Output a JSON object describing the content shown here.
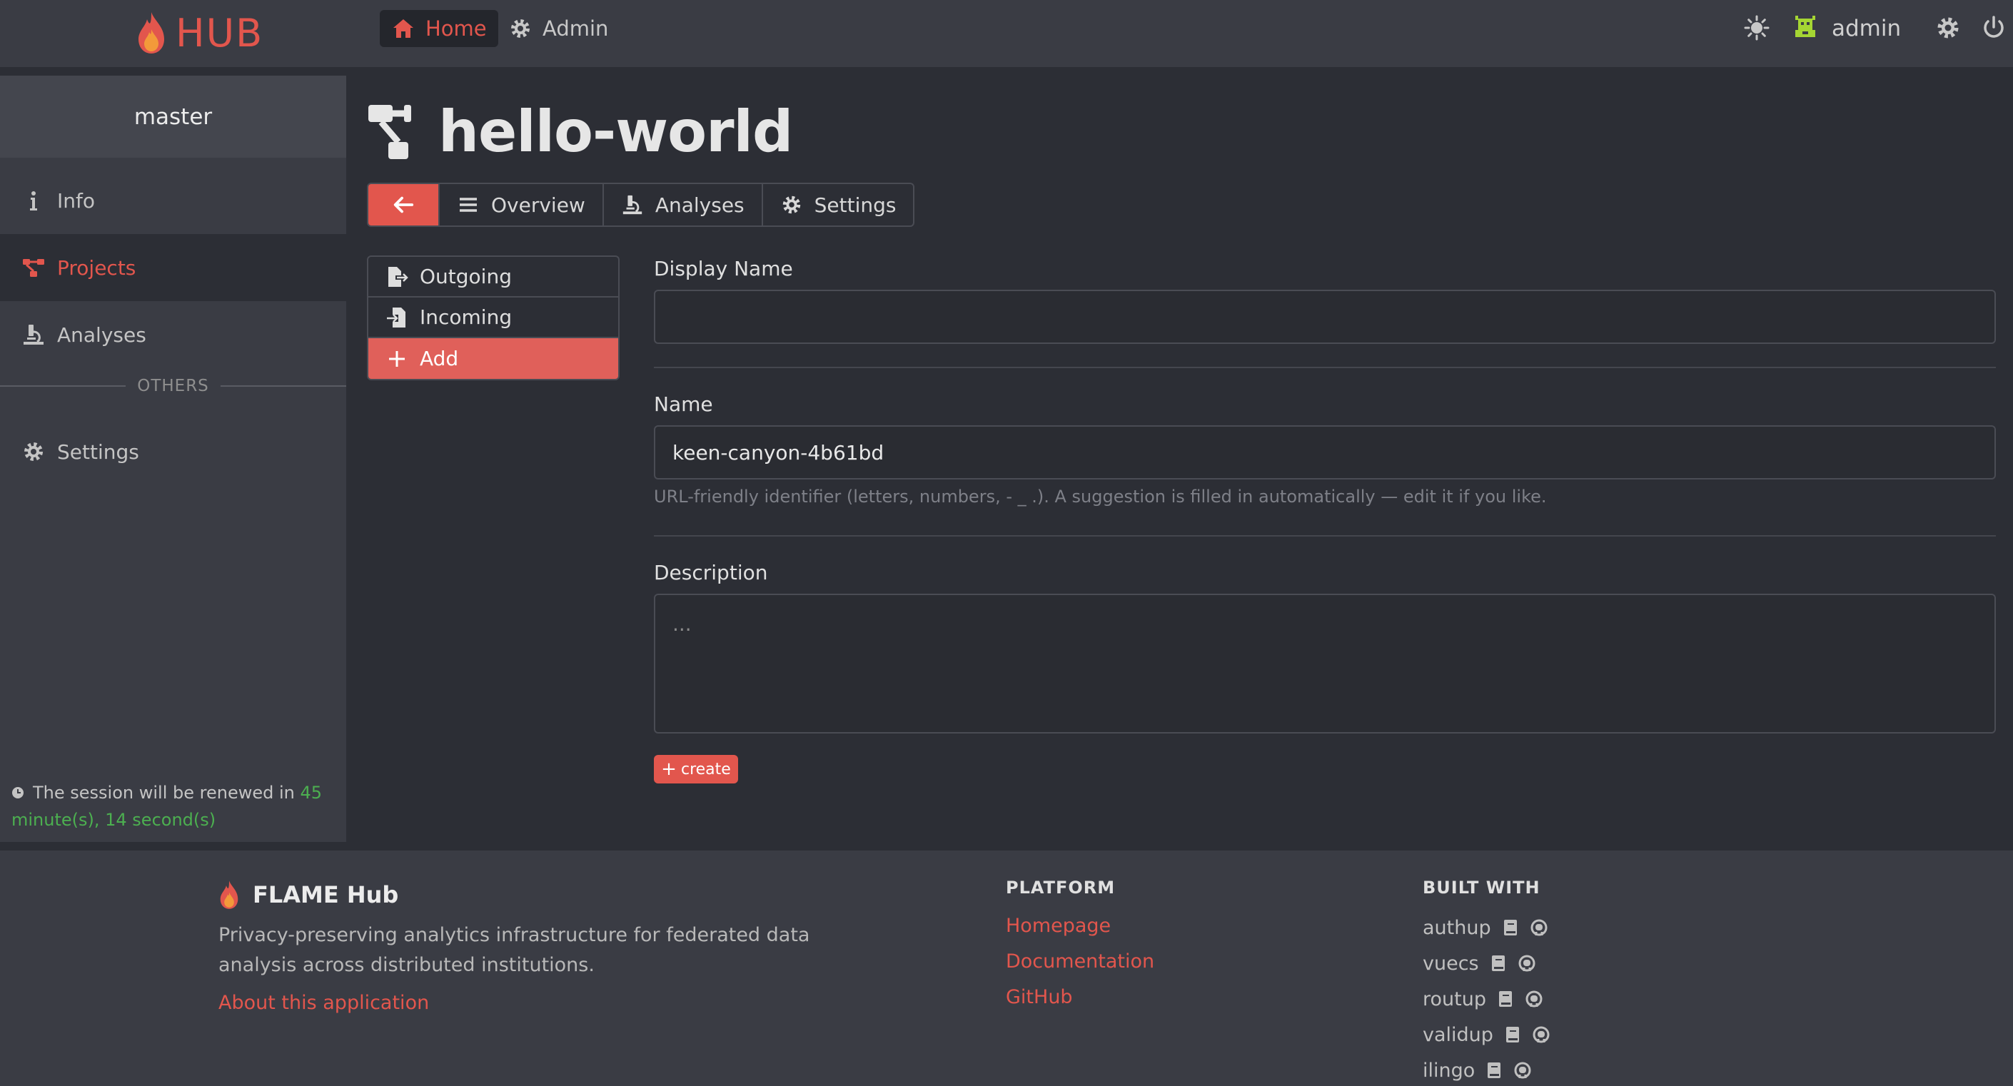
{
  "app": {
    "logo_text": "HUB"
  },
  "nav": {
    "home_label": "Home",
    "admin_label": "Admin",
    "user_name": "admin"
  },
  "sidebar": {
    "realm": "master",
    "items": [
      {
        "label": "Info",
        "icon": "info-icon"
      },
      {
        "label": "Projects",
        "icon": "projects-icon",
        "active": true
      },
      {
        "label": "Analyses",
        "icon": "microscope-icon"
      }
    ],
    "others_label": "OTHERS",
    "settings_label": "Settings",
    "session_prefix": "The session will be renewed in ",
    "session_minutes": "45",
    "session_rest": "minute(s), 14 second(s)"
  },
  "project": {
    "title": "hello-world",
    "tabs": [
      {
        "label": "Overview",
        "icon": "list-icon"
      },
      {
        "label": "Analyses",
        "icon": "microscope-icon"
      },
      {
        "label": "Settings",
        "icon": "gear-icon"
      }
    ]
  },
  "subnav": {
    "outgoing_label": "Outgoing",
    "incoming_label": "Incoming",
    "add_label": "Add"
  },
  "form": {
    "display_name_label": "Display Name",
    "display_name_value": "",
    "name_label": "Name",
    "name_value": "keen-canyon-4b61bd",
    "name_help": "URL-friendly identifier (letters, numbers, - _ .). A suggestion is filled in automatically — edit it if you like.",
    "description_label": "Description",
    "description_placeholder": "...",
    "create_label": "create"
  },
  "footer": {
    "brand": "FLAME Hub",
    "description": "Privacy-preserving analytics infrastructure for federated data analysis across distributed institutions.",
    "about_link": "About this application",
    "platform_heading": "PLATFORM",
    "platform_links": [
      "Homepage",
      "Documentation",
      "GitHub"
    ],
    "built_with_heading": "BUILT WITH",
    "built_with": [
      "authup",
      "vuecs",
      "routup",
      "validup",
      "ilingo"
    ]
  },
  "colors": {
    "accent": "#e2564d",
    "background": "#2c2e35",
    "panel": "#3a3c44",
    "session_highlight": "#4caf50"
  }
}
